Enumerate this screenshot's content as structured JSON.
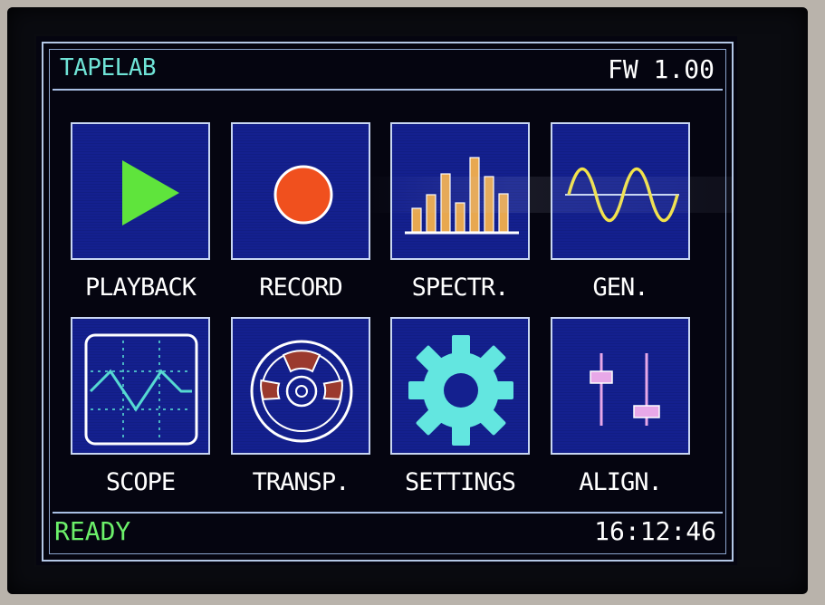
{
  "header": {
    "title": "TAPELAB",
    "firmware": "FW 1.00"
  },
  "menu": [
    {
      "label": "PLAYBACK"
    },
    {
      "label": "RECORD"
    },
    {
      "label": "SPECTR."
    },
    {
      "label": "GEN."
    },
    {
      "label": "SCOPE"
    },
    {
      "label": "TRANSP."
    },
    {
      "label": "SETTINGS"
    },
    {
      "label": "ALIGN."
    }
  ],
  "status": {
    "state": "READY",
    "time": "16:12:46"
  },
  "colors": {
    "title": "#6fe3d6",
    "ready": "#6cf06a",
    "tile_bg": "#14208f",
    "play": "#5fe43c",
    "record": "#f0501e",
    "spectrum": "#e8a850",
    "gen": "#f2e24a",
    "scope": "#56d9d2",
    "transport": "#9b3a2e",
    "settings": "#63e6e0",
    "align": "#e8a8e8"
  },
  "icons": [
    "play-icon",
    "record-icon",
    "spectrum-icon",
    "sine-wave-icon",
    "oscilloscope-icon",
    "reel-icon",
    "gear-icon",
    "slider-icon"
  ]
}
